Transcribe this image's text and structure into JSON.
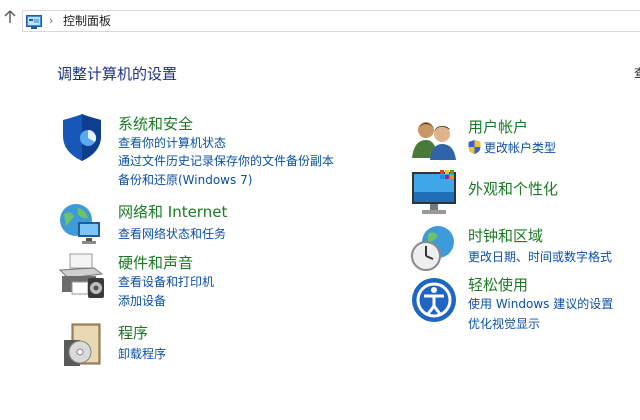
{
  "addressbar": {
    "breadcrumb": "控制面板",
    "separator": "›"
  },
  "main": {
    "title": "调整计算机的设置",
    "view_by_fragment": "查"
  },
  "left_categories": [
    {
      "title": "系统和安全",
      "links": [
        "查看你的计算机状态",
        "通过文件历史记录保存你的文件备份副本",
        "备份和还原(Windows 7)"
      ]
    },
    {
      "title": "网络和 Internet",
      "links": [
        "查看网络状态和任务"
      ]
    },
    {
      "title": "硬件和声音",
      "links": [
        "查看设备和打印机",
        "添加设备"
      ]
    },
    {
      "title": "程序",
      "links": [
        "卸载程序"
      ]
    }
  ],
  "right_categories": [
    {
      "title": "用户帐户",
      "links": [
        "更改帐户类型"
      ]
    },
    {
      "title": "外观和个性化",
      "links": []
    },
    {
      "title": "时钟和区域",
      "links": [
        "更改日期、时间或数字格式"
      ]
    },
    {
      "title": "轻松使用",
      "links": [
        "使用 Windows 建议的设置",
        "优化视觉显示"
      ]
    }
  ],
  "colors": {
    "category_title": "#1a7a24",
    "link": "#0b4fa8",
    "page_title": "#1e3287"
  }
}
